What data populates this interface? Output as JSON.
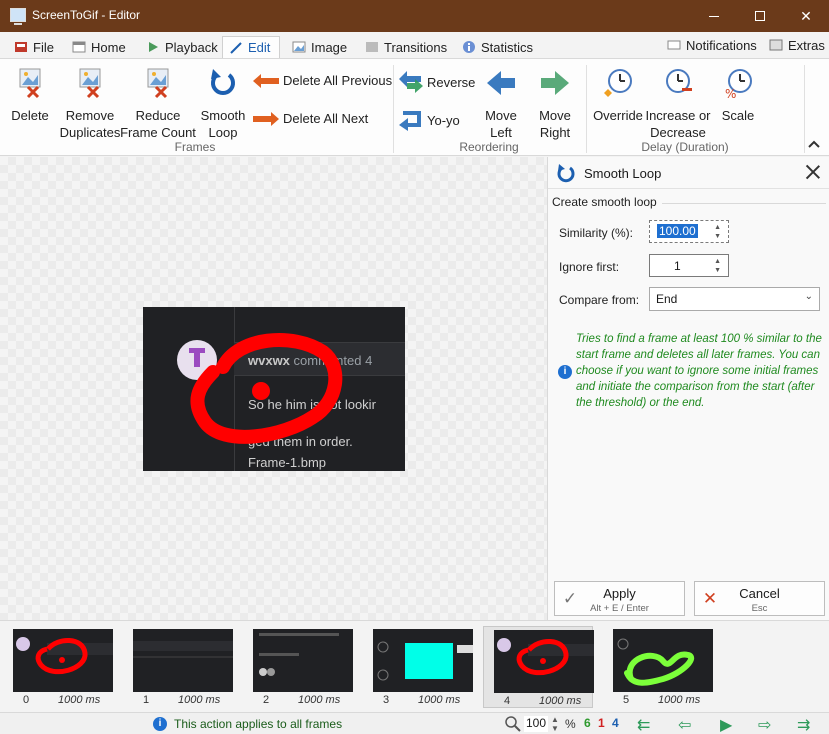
{
  "window": {
    "title": "ScreenToGif - Editor"
  },
  "tabs": [
    {
      "label": "File"
    },
    {
      "label": "Home"
    },
    {
      "label": "Playback"
    },
    {
      "label": "Edit"
    },
    {
      "label": "Image"
    },
    {
      "label": "Transitions"
    },
    {
      "label": "Statistics"
    }
  ],
  "right_tabs": {
    "notifications": "Notifications",
    "extras": "Extras"
  },
  "ribbon": {
    "frames": {
      "group_label": "Frames",
      "delete": "Delete",
      "remove_duplicates": [
        "Remove",
        "Duplicates"
      ],
      "reduce_frame_count": [
        "Reduce",
        "Frame Count"
      ],
      "smooth_loop": [
        "Smooth",
        "Loop"
      ],
      "delete_all_previous": "Delete All Previous",
      "delete_all_next": "Delete All Next"
    },
    "reordering": {
      "group_label": "Reordering",
      "reverse": "Reverse",
      "yoyo": "Yo-yo",
      "move_left": [
        "Move",
        "Left"
      ],
      "move_right": [
        "Move",
        "Right"
      ]
    },
    "delay": {
      "group_label": "Delay (Duration)",
      "override": "Override",
      "increase_decrease": [
        "Increase or",
        "Decrease"
      ],
      "scale": "Scale"
    }
  },
  "preview": {
    "header_name": "wvxwx",
    "header_rest": "commented 4",
    "line1": "So he him      is not lookir",
    "line2": "   ged them in order.",
    "line3": "Frame-1.bmp"
  },
  "panel": {
    "title": "Smooth Loop",
    "section": "Create smooth loop",
    "similarity_label": "Similarity (%):",
    "similarity_value": "100.00",
    "ignore_label": "Ignore first:",
    "ignore_value": "1",
    "compare_label": "Compare from:",
    "compare_value": "End",
    "info_text": "Tries to find a frame at least 100 % similar to the start frame and deletes all later frames. You can choose if you want to ignore some initial frames and initiate the comparison from the start (after the threshold) or the end.",
    "apply_label": "Apply",
    "apply_shortcut": "Alt + E / Enter",
    "cancel_label": "Cancel",
    "cancel_shortcut": "Esc"
  },
  "frames": [
    {
      "index": "0",
      "delay": "1000 ms"
    },
    {
      "index": "1",
      "delay": "1000 ms"
    },
    {
      "index": "2",
      "delay": "1000 ms"
    },
    {
      "index": "3",
      "delay": "1000 ms"
    },
    {
      "index": "4",
      "delay": "1000 ms"
    },
    {
      "index": "5",
      "delay": "1000 ms"
    }
  ],
  "selected_frame": 4,
  "status": {
    "message": "This action applies to all frames",
    "zoom": "100",
    "zoom_unit": "%",
    "total": "6",
    "selected": "1",
    "current": "4"
  },
  "colors": {
    "accent": "#1c5fb0",
    "titlebar": "#6b3a1a",
    "green": "#2e9a5a",
    "orange": "#e06020",
    "red_marker": "#ff0000",
    "cyan": "#00ffe8",
    "lime": "#7cff3a"
  }
}
